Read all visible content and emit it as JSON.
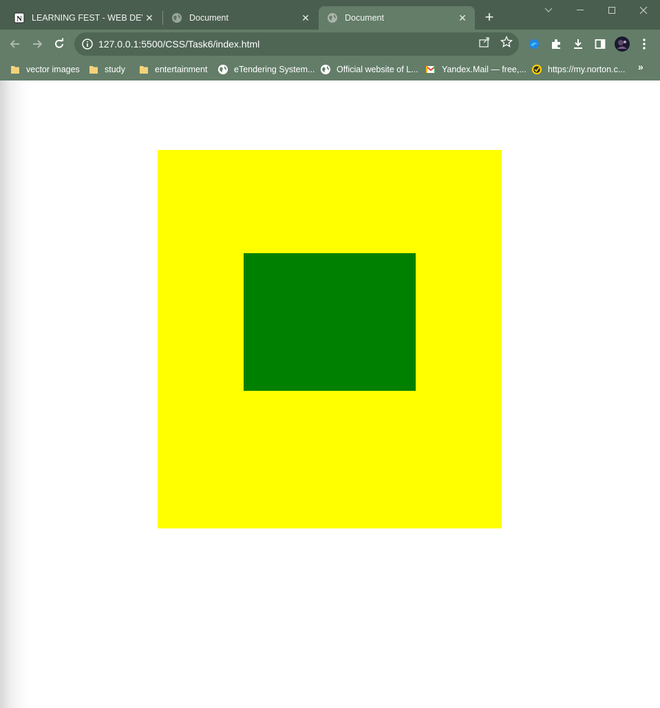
{
  "browser": {
    "tabs": [
      {
        "title": "LEARNING FEST - WEB DEVELO",
        "favicon": "notion-icon",
        "active": false
      },
      {
        "title": "Document",
        "favicon": "globe-icon",
        "active": false
      },
      {
        "title": "Document",
        "favicon": "globe-icon",
        "active": true
      }
    ],
    "new_tab": "+",
    "address": {
      "url": "127.0.0.1:5500/CSS/Task6/index.html"
    },
    "bookmarks": [
      {
        "label": "vector images",
        "icon": "folder-icon"
      },
      {
        "label": "study",
        "icon": "folder-icon"
      },
      {
        "label": "entertainment",
        "icon": "folder-icon"
      },
      {
        "label": "eTendering System...",
        "icon": "globe-icon"
      },
      {
        "label": "Official website of L...",
        "icon": "globe-icon"
      },
      {
        "label": "Yandex.Mail — free,...",
        "icon": "gmail-icon"
      },
      {
        "label": "https://my.norton.c...",
        "icon": "norton-icon"
      }
    ],
    "bookmarks_more": "»",
    "colors": {
      "frame": "#4a5e4f",
      "toolbar": "#637d69",
      "omnibox": "#4f6655"
    }
  },
  "page": {
    "outer_box": {
      "color": "#ffff00"
    },
    "inner_box": {
      "color": "#008000"
    }
  }
}
